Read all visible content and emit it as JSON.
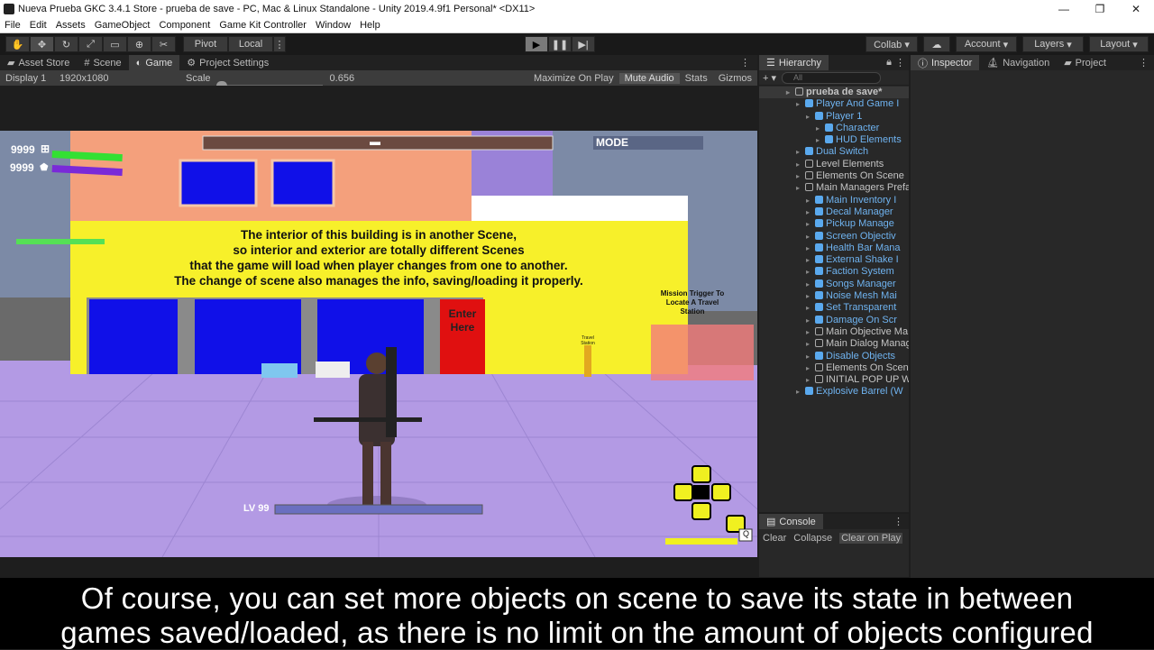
{
  "window": {
    "title": "Nueva Prueba GKC 3.4.1 Store - prueba de save - PC, Mac & Linux Standalone - Unity 2019.4.9f1 Personal* <DX11>",
    "controls": [
      "—",
      "❐",
      "✕"
    ]
  },
  "menu": [
    "File",
    "Edit",
    "Assets",
    "GameObject",
    "Component",
    "Game Kit Controller",
    "Window",
    "Help"
  ],
  "toolbar": {
    "pivot": "Pivot",
    "local": "Local",
    "collab": "Collab ▾",
    "account": "Account",
    "layers": "Layers",
    "layout": "Layout"
  },
  "tabs": {
    "left": [
      "Asset Store",
      "Scene",
      "Game",
      "Project Settings"
    ],
    "active": "Game",
    "hierarchy": "Hierarchy",
    "inspector": "Inspector",
    "navigation": "Navigation",
    "project": "Project",
    "console": "Console"
  },
  "gamebar": {
    "display": "Display 1",
    "resolution": "1920x1080",
    "scale_label": "Scale",
    "scale_value": "0.656",
    "maximize": "Maximize On Play",
    "mute": "Mute Audio",
    "stats": "Stats",
    "gizmos": "Gizmos"
  },
  "hierarchy": {
    "search_placeholder": "All",
    "items": [
      {
        "label": "prueba de save*",
        "indent": 0,
        "type": "scene"
      },
      {
        "label": "Player And Game I",
        "indent": 1,
        "type": "prefab"
      },
      {
        "label": "Player 1",
        "indent": 2,
        "type": "prefab"
      },
      {
        "label": "Character",
        "indent": 3,
        "type": "prefab"
      },
      {
        "label": "HUD Elements",
        "indent": 3,
        "type": "prefab"
      },
      {
        "label": "Dual Switch",
        "indent": 1,
        "type": "prefab"
      },
      {
        "label": "Level Elements",
        "indent": 1,
        "type": "object"
      },
      {
        "label": "Elements On Scene",
        "indent": 1,
        "type": "object"
      },
      {
        "label": "Main Managers Prefa",
        "indent": 1,
        "type": "object"
      },
      {
        "label": "Main Inventory I",
        "indent": 2,
        "type": "prefab"
      },
      {
        "label": "Decal Manager",
        "indent": 2,
        "type": "prefab"
      },
      {
        "label": "Pickup Manage",
        "indent": 2,
        "type": "prefab"
      },
      {
        "label": "Screen Objectiv",
        "indent": 2,
        "type": "prefab"
      },
      {
        "label": "Health Bar Mana",
        "indent": 2,
        "type": "prefab"
      },
      {
        "label": "External Shake I",
        "indent": 2,
        "type": "prefab"
      },
      {
        "label": "Faction System",
        "indent": 2,
        "type": "prefab"
      },
      {
        "label": "Songs Manager",
        "indent": 2,
        "type": "prefab"
      },
      {
        "label": "Noise Mesh Mai",
        "indent": 2,
        "type": "prefab"
      },
      {
        "label": "Set Transparent",
        "indent": 2,
        "type": "prefab"
      },
      {
        "label": "Damage On Scr",
        "indent": 2,
        "type": "prefab"
      },
      {
        "label": "Main Objective Ma",
        "indent": 2,
        "type": "object"
      },
      {
        "label": "Main Dialog Manag",
        "indent": 2,
        "type": "object"
      },
      {
        "label": "Disable Objects",
        "indent": 2,
        "type": "prefab"
      },
      {
        "label": "Elements On Scene",
        "indent": 2,
        "type": "object"
      },
      {
        "label": "INITIAL POP UP WI",
        "indent": 2,
        "type": "object"
      },
      {
        "label": "Explosive Barrel (W",
        "indent": 1,
        "type": "prefab"
      }
    ]
  },
  "console": {
    "clear": "Clear",
    "collapse": "Collapse",
    "clear_on_play": "Clear on Play"
  },
  "game": {
    "hud_health": "9999",
    "hud_shield": "9999",
    "mode": "MODE",
    "sign_lines": [
      "The interior of this building is in another Scene,",
      "so interior and exterior are totally different Scenes",
      "that the game will load when player changes from one to another.",
      "The change of scene also manages the info, saving/loading it properly."
    ],
    "door": "Enter Here",
    "mission": "Mission Trigger To Locate A Travel Station",
    "travel": "Travel Station",
    "level": "LV 99",
    "key_hint": "Q"
  },
  "subtitle": {
    "line1": "Of course, you can set more objects on scene to save its state in between",
    "line2": "games saved/loaded, as there is no limit on the amount of objects configured"
  },
  "colors": {
    "editor_bg": "#282828",
    "blue_prefab": "#6fb3f0",
    "building_yellow": "#f7f02a",
    "building_pink": "#f4a07c",
    "floor_purple": "#b49be6"
  }
}
